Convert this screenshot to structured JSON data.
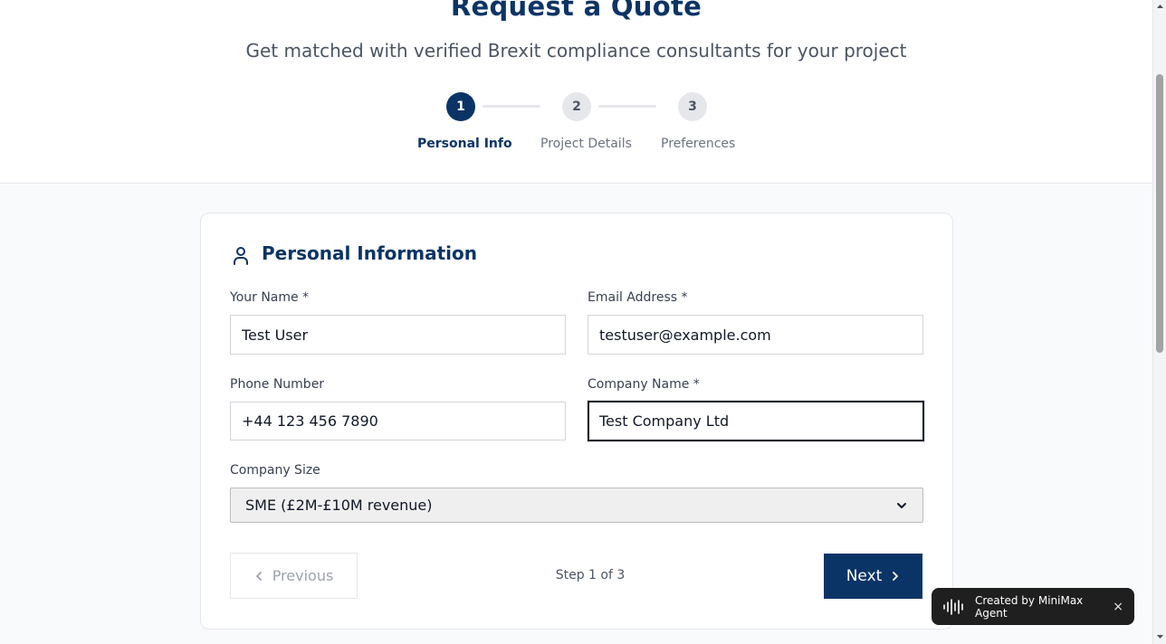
{
  "header": {
    "title": "Request a Quote",
    "subtitle": "Get matched with verified Brexit compliance consultants for your project"
  },
  "stepper": {
    "steps": [
      {
        "number": "1",
        "label": "Personal Info",
        "active": true
      },
      {
        "number": "2",
        "label": "Project Details",
        "active": false
      },
      {
        "number": "3",
        "label": "Preferences",
        "active": false
      }
    ]
  },
  "form": {
    "section_title": "Personal Information",
    "fields": {
      "name": {
        "label": "Your Name *",
        "value": "Test User"
      },
      "email": {
        "label": "Email Address *",
        "value": "testuser@example.com"
      },
      "phone": {
        "label": "Phone Number",
        "value": "+44 123 456 7890"
      },
      "company": {
        "label": "Company Name *",
        "value": "Test Company Ltd"
      },
      "company_size": {
        "label": "Company Size",
        "value": "SME (£2M-£10M revenue)"
      }
    }
  },
  "navigation": {
    "previous_label": "Previous",
    "next_label": "Next",
    "step_counter": "Step 1 of 3"
  },
  "badge": {
    "text": "Created by MiniMax Agent",
    "close": "×"
  },
  "colors": {
    "primary": "#0b3466",
    "background": "#f8fafc",
    "badge_bg": "#1f1f1f"
  },
  "icons": {
    "section": "user-icon",
    "prev": "chevron-left-icon",
    "next": "chevron-right-icon",
    "badge": "waveform-icon",
    "select": "chevron-down-icon"
  }
}
